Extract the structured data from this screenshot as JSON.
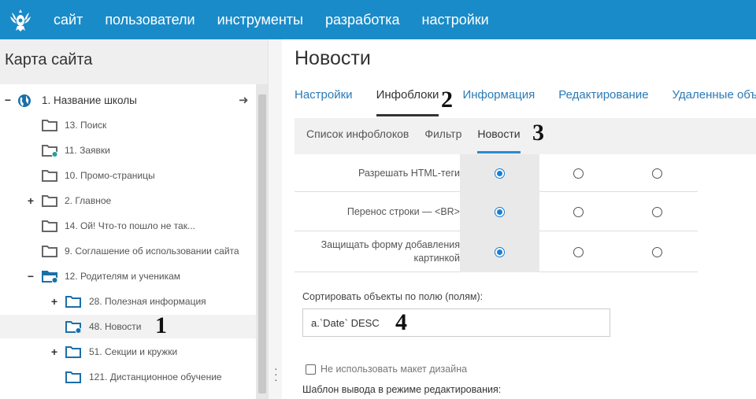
{
  "topnav": [
    "сайт",
    "пользователи",
    "инструменты",
    "разработка",
    "настройки"
  ],
  "sidebar": {
    "title": "Карта сайта",
    "tree": [
      {
        "label": "1. Название школы",
        "expander": "−",
        "icon": "globe",
        "root": true
      },
      {
        "label": "13. Поиск",
        "expander": "",
        "icon": "folder"
      },
      {
        "label": "11. Заявки",
        "expander": "",
        "icon": "folder-dot"
      },
      {
        "label": "10. Промо-страницы",
        "expander": "",
        "icon": "folder"
      },
      {
        "label": "2. Главное",
        "expander": "+",
        "icon": "folder"
      },
      {
        "label": "14. Ой! Что-то пошло не так...",
        "expander": "",
        "icon": "folder"
      },
      {
        "label": "9. Соглашение об использовании сайта",
        "expander": "",
        "icon": "folder"
      },
      {
        "label": "12. Родителям и ученикам",
        "expander": "−",
        "icon": "folder-open-dot"
      },
      {
        "label": "28. Полезная информация",
        "expander": "+",
        "icon": "folder-blue",
        "level": 2
      },
      {
        "label": "48. Новости",
        "expander": "",
        "icon": "folder-blue-dot",
        "level": 2,
        "selected": true
      },
      {
        "label": "51. Секции и кружки",
        "expander": "+",
        "icon": "folder-blue",
        "level": 2
      },
      {
        "label": "121. Дистанционное обучение",
        "expander": "",
        "icon": "folder-blue",
        "level": 2
      }
    ]
  },
  "main": {
    "title": "Новости",
    "tabs": [
      "Настройки",
      "Инфоблоки",
      "Информация",
      "Редактирование",
      "Удаленные объе"
    ],
    "subtabs": [
      "Список инфоблоков",
      "Фильтр",
      "Новости"
    ],
    "settings": [
      {
        "label": "Разрешать HTML-теги",
        "selected": 0
      },
      {
        "label": "Перенос строки — <BR>",
        "selected": 0
      },
      {
        "label": "Защищать форму добавления картинкой",
        "selected": 0
      }
    ],
    "sort_label": "Сортировать объекты по полю (полям):",
    "sort_value": "a.`Date` DESC",
    "checkbox_label": "Не использовать макет дизайна",
    "template_label": "Шаблон вывода в режиме редактирования:"
  },
  "annotations": [
    "1",
    "2",
    "3",
    "4"
  ],
  "colors": {
    "header": "#1a8bc9",
    "link": "#2a7ab6",
    "radio": "#1b7fd1",
    "folder": "#666666",
    "folder_active": "#1a6fa8",
    "dot": "#1ca39e"
  }
}
